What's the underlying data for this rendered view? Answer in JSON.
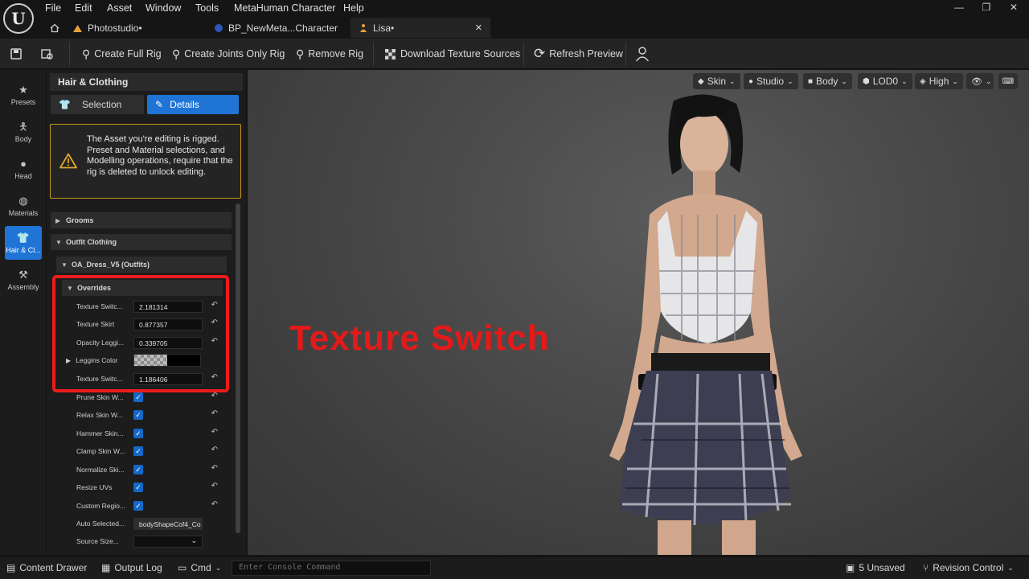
{
  "menu": [
    "File",
    "Edit",
    "Asset",
    "Window",
    "Tools",
    "MetaHuman Character",
    "Help"
  ],
  "tabs": [
    {
      "label": "Photostudio•"
    },
    {
      "label": "BP_NewMeta...Character"
    },
    {
      "label": "Lisa•",
      "active": true
    }
  ],
  "toolbar": {
    "create_full_rig": "Create Full Rig",
    "create_joints_only_rig": "Create Joints Only Rig",
    "remove_rig": "Remove Rig",
    "download_texture_sources": "Download Texture Sources",
    "refresh_preview": "Refresh Preview"
  },
  "rail": [
    {
      "label": "Presets",
      "icon": "star-icon"
    },
    {
      "label": "Body",
      "icon": "body-icon"
    },
    {
      "label": "Head",
      "icon": "head-icon"
    },
    {
      "label": "Materials",
      "icon": "materials-icon"
    },
    {
      "label": "Hair & Cl...",
      "icon": "hair-clothing-icon",
      "active": true
    },
    {
      "label": "Assembly",
      "icon": "hammer-icon"
    }
  ],
  "panel": {
    "title": "Hair & Clothing",
    "selection_label": "Selection",
    "details_label": "Details",
    "warning": "The Asset you're editing is rigged. Preset and Material selections, and Modelling operations, require that the rig is deleted to unlock editing.",
    "grooms": "Grooms",
    "outfit_clothing": "Outfit Clothing",
    "outfit_name": "OA_Dress_V5 (Outfits)",
    "overrides": "Overrides",
    "rows": [
      {
        "label": "Texture Switc...",
        "value": "2.181314"
      },
      {
        "label": "Texture Skirt",
        "value": "0.877357"
      },
      {
        "label": "Opacity Leggi...",
        "value": "0.339705"
      },
      {
        "label": "Leggins Color",
        "value": ""
      },
      {
        "label": "Texture Switc...",
        "value": "1.186406"
      },
      {
        "label": "Prune Skin W...",
        "value": "checked"
      },
      {
        "label": "Relax Skin W...",
        "value": "checked"
      },
      {
        "label": "Hammer Skin...",
        "value": "checked"
      },
      {
        "label": "Clamp Skin W...",
        "value": "checked"
      },
      {
        "label": "Normalize Ski...",
        "value": "checked"
      },
      {
        "label": "Resize UVs",
        "value": "checked"
      },
      {
        "label": "Custom Regio...",
        "value": "checked"
      },
      {
        "label": "Auto Selected...",
        "value": "bodyShapeCof4_Co"
      },
      {
        "label": "Source Size...",
        "value": ""
      }
    ]
  },
  "viewport": {
    "buttons": [
      {
        "label": "Skin",
        "icon": "skin-icon"
      },
      {
        "label": "Studio",
        "icon": "light-icon"
      },
      {
        "label": "Body",
        "icon": "camera-icon"
      },
      {
        "label": "LOD0",
        "icon": "cube-icon"
      },
      {
        "label": "High",
        "icon": "quality-icon"
      }
    ],
    "overlay_text": "Texture Switch"
  },
  "statusbar": {
    "content_drawer": "Content Drawer",
    "output_log": "Output Log",
    "cmd": "Cmd",
    "console_placeholder": "Enter Console Command",
    "unsaved": "5 Unsaved",
    "revision_control": "Revision Control"
  },
  "colors": {
    "accent": "#1f74d6",
    "warning": "#c8961e",
    "highlight": "#ec1c1c"
  }
}
